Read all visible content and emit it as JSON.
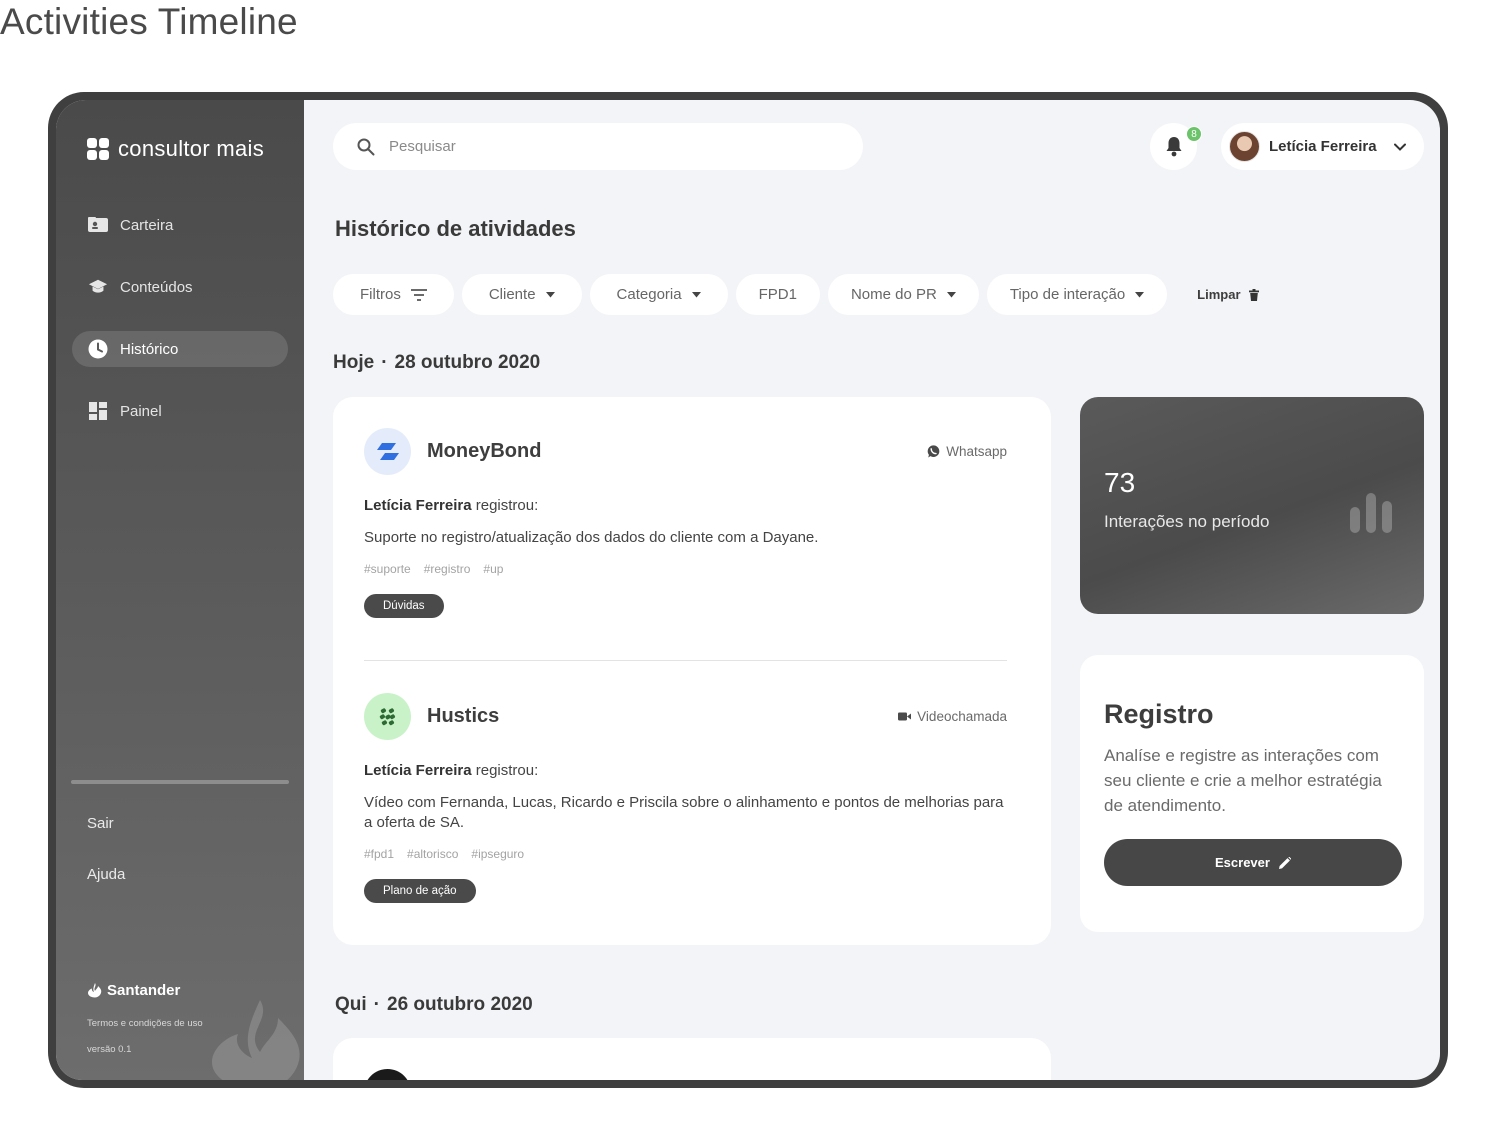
{
  "page": {
    "heading": "Activities Timeline"
  },
  "app": {
    "logo_text": "consultor mais"
  },
  "sidebar": {
    "items": [
      {
        "label": "Carteira",
        "icon": "wallet-icon"
      },
      {
        "label": "Conteúdos",
        "icon": "graduation-cap-icon"
      },
      {
        "label": "Histórico",
        "icon": "clock-icon",
        "active": true
      },
      {
        "label": "Painel",
        "icon": "dashboard-icon"
      }
    ],
    "logout_label": "Sair",
    "help_label": "Ajuda",
    "brand": "Santander",
    "terms": "Termos e condições de uso",
    "version": "versão 0.1"
  },
  "header": {
    "search_placeholder": "Pesquisar",
    "notifications_count": "8",
    "user_name": "Letícia Ferreira"
  },
  "main": {
    "title": "Histórico de atividades",
    "filters": [
      "Filtros",
      "Cliente",
      "Categoria",
      "FPD1",
      "Nome do PR",
      "Tipo de interação"
    ],
    "clear_label": "Limpar"
  },
  "timeline": {
    "day1": {
      "day": "Hoje",
      "date": "28 outubro 2020"
    },
    "day2": {
      "day": "Qui",
      "date": "26 outubro 2020"
    },
    "activities": [
      {
        "client": "MoneyBond",
        "channel": "Whatsapp",
        "author": "Letícia Ferreira",
        "action": " registrou:",
        "description": "Suporte no registro/atualização dos dados do cliente com a Dayane.",
        "tags": [
          "#suporte",
          "#registro",
          "#up"
        ],
        "category": "Dúvidas"
      },
      {
        "client": "Hustics",
        "channel": "Videochamada",
        "author": "Letícia Ferreira",
        "action": " registrou:",
        "description": "Vídeo com Fernanda, Lucas, Ricardo e Priscila sobre o alinhamento e pontos de melhorias para a oferta de SA.",
        "tags": [
          "#fpd1",
          "#altorisco",
          "#ipseguro"
        ],
        "category": "Plano de ação"
      }
    ]
  },
  "stats": {
    "value": "73",
    "label": "Interações no período"
  },
  "registro": {
    "title": "Registro",
    "text": "Analíse e registre as interações com seu cliente e crie a melhor estratégia de atendimento.",
    "button_label": "Escrever"
  },
  "colors": {
    "sidebar": "#4a4a4a",
    "accent_dark": "#474747",
    "badge_green": "#6cc36b",
    "moneybond_blue": "#2f6fe0",
    "hustics_green": "#2e8b3a"
  }
}
